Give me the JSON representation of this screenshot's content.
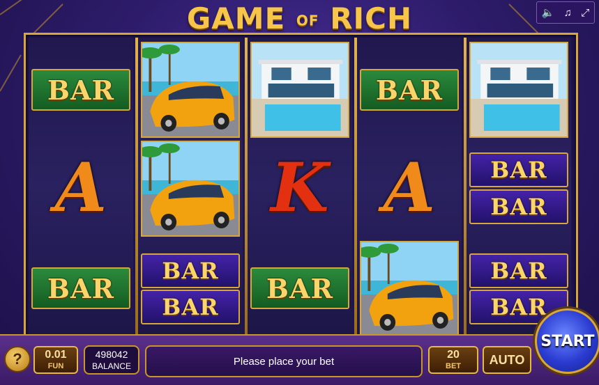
{
  "title": {
    "part1": "GAME",
    "part2": "OF",
    "part3": "RICH"
  },
  "top_icons": [
    "speaker-icon",
    "music-icon",
    "fullscreen-icon"
  ],
  "reels": [
    [
      {
        "type": "bar",
        "style": "green",
        "label": "BAR"
      },
      {
        "type": "letter",
        "label": "A",
        "color": "#f08a1a"
      },
      {
        "type": "bar",
        "style": "green",
        "label": "BAR"
      }
    ],
    [
      {
        "type": "image",
        "name": "sports-car"
      },
      {
        "type": "image",
        "name": "sports-car"
      },
      {
        "type": "bar",
        "style": "purple",
        "label": "BAR"
      },
      {
        "type": "bar",
        "style": "purple",
        "label": "BAR"
      }
    ],
    [
      {
        "type": "image",
        "name": "villa-pool"
      },
      {
        "type": "letter",
        "label": "K",
        "color": "#e23010"
      },
      {
        "type": "bar",
        "style": "green",
        "label": "BAR"
      }
    ],
    [
      {
        "type": "bar",
        "style": "green",
        "label": "BAR"
      },
      {
        "type": "letter",
        "label": "A",
        "color": "#f08a1a"
      },
      {
        "type": "image",
        "name": "sports-car"
      }
    ],
    [
      {
        "type": "image",
        "name": "villa-pool"
      },
      {
        "type": "bar",
        "style": "purple",
        "label": "BAR"
      },
      {
        "type": "bar",
        "style": "purple",
        "label": "BAR"
      },
      {
        "type": "bar",
        "style": "purple",
        "label": "BAR"
      },
      {
        "type": "bar",
        "style": "purple",
        "label": "BAR"
      }
    ]
  ],
  "controls": {
    "help_label": "?",
    "coin_value": "0.01",
    "coin_label": "FUN",
    "balance_value": "498042",
    "balance_label": "BALANCE",
    "message": "Please place your bet",
    "bet_value": "20",
    "bet_label": "BET",
    "auto_label": "AUTO",
    "start_label": "START"
  },
  "colors": {
    "gold": "#d9a638",
    "background": "#2e1c6b",
    "start_button": "#2a3bd0"
  }
}
